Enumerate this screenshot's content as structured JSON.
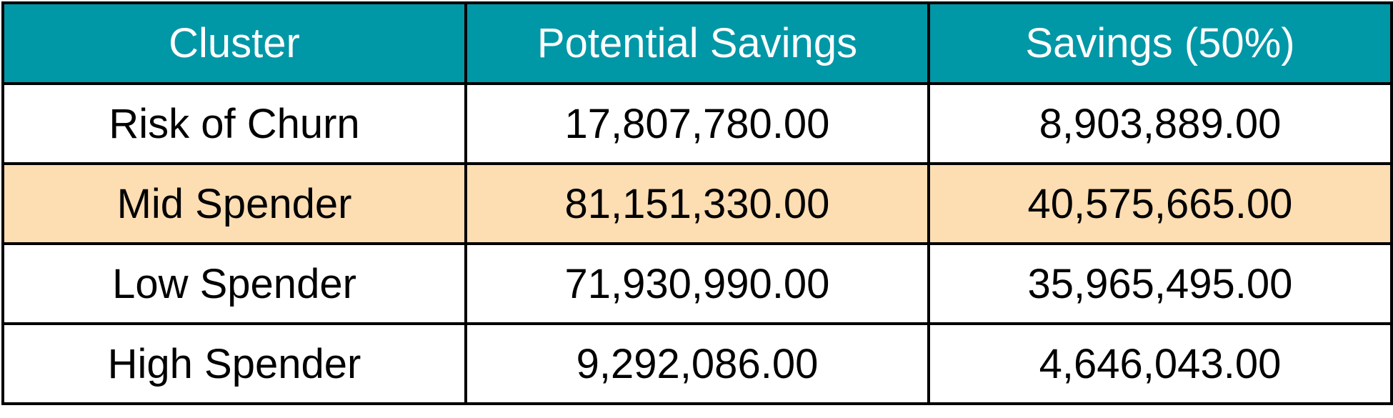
{
  "chart_data": {
    "type": "table",
    "columns": [
      "Cluster",
      "Potential Savings",
      "Savings (50%)"
    ],
    "rows": [
      {
        "cluster": "Risk of Churn",
        "potential_savings": "17,807,780.00",
        "savings_50": "8,903,889.00",
        "highlighted": false
      },
      {
        "cluster": "Mid Spender",
        "potential_savings": "81,151,330.00",
        "savings_50": "40,575,665.00",
        "highlighted": true
      },
      {
        "cluster": "Low Spender",
        "potential_savings": "71,930,990.00",
        "savings_50": "35,965,495.00",
        "highlighted": false
      },
      {
        "cluster": "High Spender",
        "potential_savings": "9,292,086.00",
        "savings_50": "4,646,043.00",
        "highlighted": false
      }
    ]
  },
  "colors": {
    "header_bg": "#0097A7",
    "header_text": "#FFFFFF",
    "highlight_row": "#FDDDB2",
    "border": "#000000"
  }
}
